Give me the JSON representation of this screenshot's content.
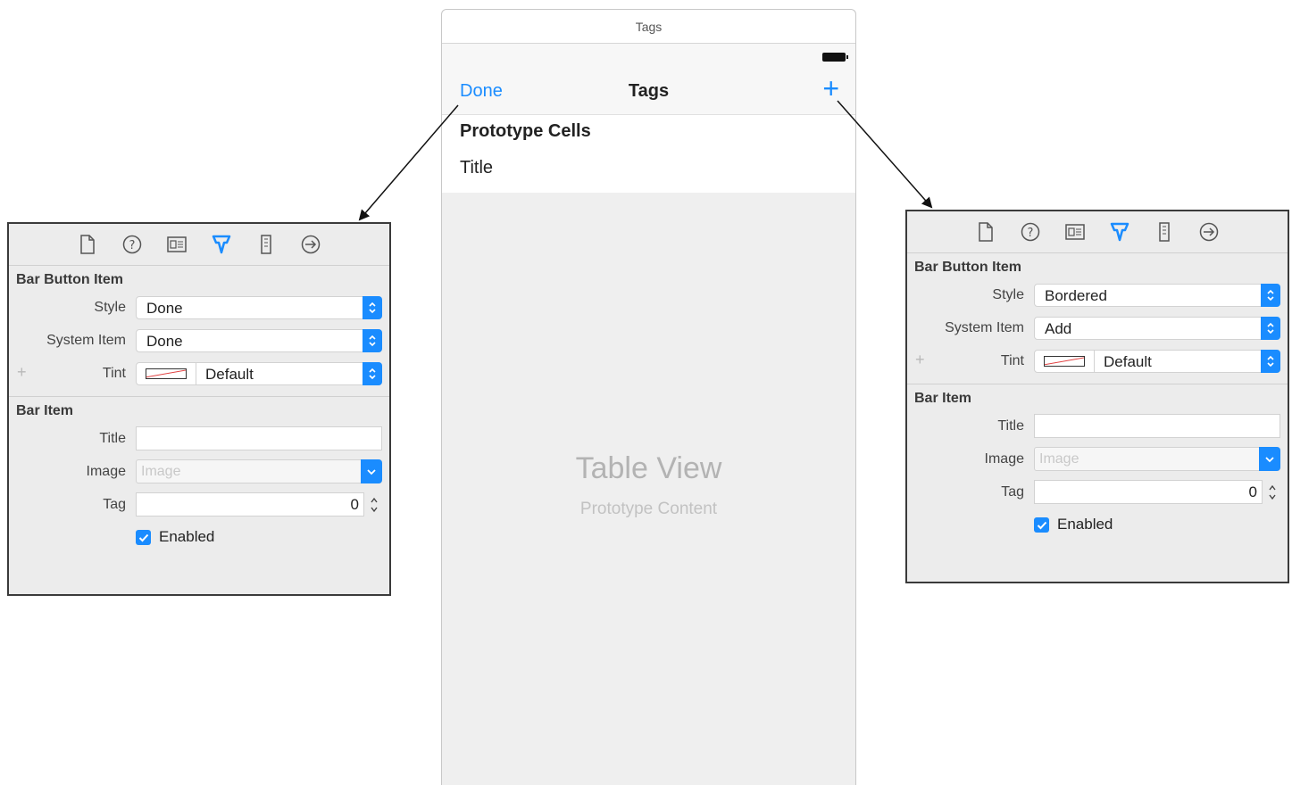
{
  "scene": {
    "window_title": "Tags",
    "nav": {
      "left_button": "Done",
      "title": "Tags",
      "right_button": "+"
    },
    "prototype_header": "Prototype Cells",
    "cell_title": "Title",
    "table_placeholder": "Table View",
    "table_placeholder_sub": "Prototype Content"
  },
  "inspectors": {
    "left": {
      "section1": "Bar Button Item",
      "style_label": "Style",
      "style_value": "Done",
      "system_item_label": "System Item",
      "system_item_value": "Done",
      "tint_label": "Tint",
      "tint_value": "Default",
      "section2": "Bar Item",
      "title_label": "Title",
      "title_value": "",
      "image_label": "Image",
      "image_placeholder": "Image",
      "tag_label": "Tag",
      "tag_value": "0",
      "enabled_label": "Enabled"
    },
    "right": {
      "section1": "Bar Button Item",
      "style_label": "Style",
      "style_value": "Bordered",
      "system_item_label": "System Item",
      "system_item_value": "Add",
      "tint_label": "Tint",
      "tint_value": "Default",
      "section2": "Bar Item",
      "title_label": "Title",
      "title_value": "",
      "image_label": "Image",
      "image_placeholder": "Image",
      "tag_label": "Tag",
      "tag_value": "0",
      "enabled_label": "Enabled"
    }
  },
  "toolbar_icons": [
    "file-icon",
    "help-icon",
    "identity-icon",
    "attributes-icon",
    "size-icon",
    "connections-icon"
  ],
  "colors": {
    "accent": "#1a8cff",
    "panel_bg": "#ececec",
    "table_bg": "#efefef"
  }
}
